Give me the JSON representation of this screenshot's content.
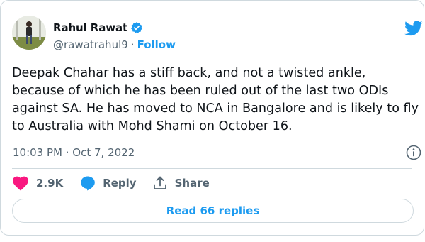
{
  "tweet": {
    "author_name": "Rahul Rawat",
    "handle": "@rawatrahul9",
    "separator": "·",
    "follow_label": "Follow",
    "text": "Deepak Chahar has a stiff back, and not a twisted ankle, because of which he has been ruled out of the last two ODIs against SA. He has moved to NCA in Bangalore and is likely to fly to Australia with Mohd Shami on October 16.",
    "timestamp": "10:03 PM · Oct 7, 2022"
  },
  "actions": {
    "like_count": "2.9K",
    "reply_label": "Reply",
    "share_label": "Share"
  },
  "read_replies_label": "Read 66 replies",
  "icons": {
    "brand": "twitter-bird-icon",
    "verified": "verified-badge-icon",
    "info": "info-icon",
    "like": "heart-icon",
    "reply": "speech-bubble-icon",
    "share": "share-upload-icon"
  },
  "colors": {
    "accent": "#1d9bf0",
    "like": "#f91880",
    "text": "#0f1419",
    "secondary": "#536471",
    "border": "#cfd9de"
  }
}
